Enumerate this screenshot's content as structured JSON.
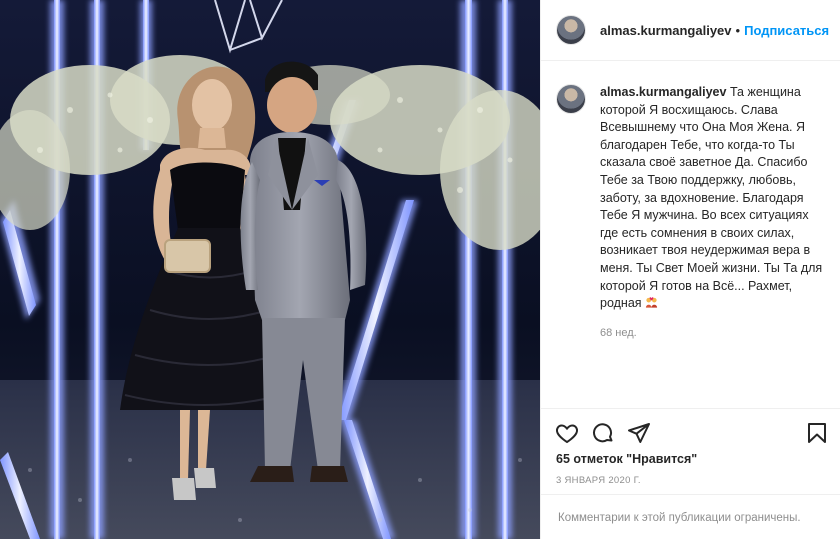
{
  "post": {
    "photo_alt": "Couple posing at an event"
  },
  "header": {
    "username": "almas.kurmangaliyev",
    "separator": "•",
    "follow_label": "Подписаться"
  },
  "caption": {
    "username": "almas.kurmangaliyev",
    "text": "Та женщина которой Я восхищаюсь. Слава Всевышнему что Она Моя Жена. Я благодарен Тебе, что когда-то Ты сказала своё заветное Да. Спасибо Тебе за Твою поддержку, любовь, заботу, за вдохновение. Благодаря Тебе Я мужчина. Во всех ситуациях где есть сомнения в своих силах, возникает твоя неудержимая вера в меня. Ты Свет Моей жизни. Ты Та для которой Я готов на Всё... Рахмет, родная",
    "emoji": "couple-with-heart-emoji",
    "time": "68 нед."
  },
  "actions": {
    "like_icon": "heart-icon",
    "comment_icon": "comment-icon",
    "share_icon": "paper-plane-icon",
    "save_icon": "bookmark-icon"
  },
  "likes_text": "65 отметок \"Нравится\"",
  "date_text": "3 ЯНВАРЯ 2020 Г.",
  "comments_note": "Комментарии к этой публикации ограничены.",
  "colors": {
    "accent": "#0095f6",
    "text": "#262626",
    "muted": "#8e8e8e",
    "border": "#efefef"
  }
}
